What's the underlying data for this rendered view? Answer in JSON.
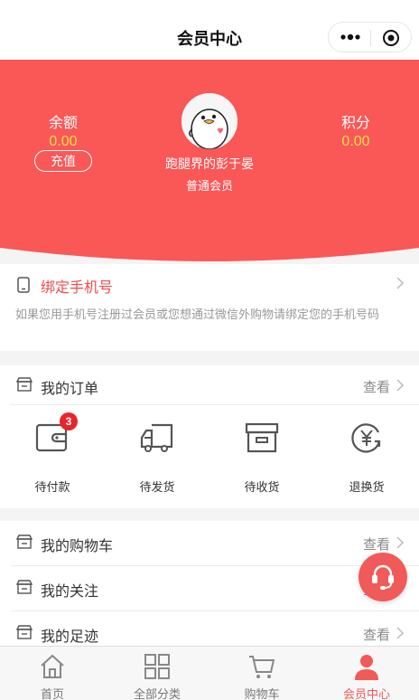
{
  "navbar": {
    "title": "会员中心",
    "menu_icon": "more-dots-icon",
    "close_icon": "target-icon"
  },
  "header": {
    "bg_color": "#fa5757",
    "balance": {
      "label": "余额",
      "value": "0.00"
    },
    "recharge_label": "充值",
    "points": {
      "label": "积分",
      "value": "0.00"
    },
    "nickname": "跑腿界的彭于晏",
    "level": "普通会员",
    "value_color": "#ffe14d"
  },
  "bind_phone": {
    "title": "绑定手机号",
    "description": "如果您用手机号注册过会员或您想通过微信外购物请绑定您的手机号码"
  },
  "orders": {
    "title": "我的订单",
    "more_label": "查看",
    "items": [
      {
        "label": "待付款",
        "icon": "wallet-icon",
        "badge": "3"
      },
      {
        "label": "待发货",
        "icon": "truck-icon"
      },
      {
        "label": "待收货",
        "icon": "box-icon"
      },
      {
        "label": "退换货",
        "icon": "refund-icon"
      }
    ]
  },
  "links": [
    {
      "title": "我的购物车",
      "more_label": "查看"
    },
    {
      "title": "我的关注",
      "more_label": "查看"
    },
    {
      "title": "我的足迹",
      "more_label": "查看"
    }
  ],
  "tabbar": {
    "active_color": "#f05a58",
    "items": [
      {
        "label": "首页",
        "icon": "home-icon"
      },
      {
        "label": "全部分类",
        "icon": "grid-icon"
      },
      {
        "label": "购物车",
        "icon": "cart-icon"
      },
      {
        "label": "会员中心",
        "icon": "user-icon",
        "active": true
      }
    ]
  }
}
